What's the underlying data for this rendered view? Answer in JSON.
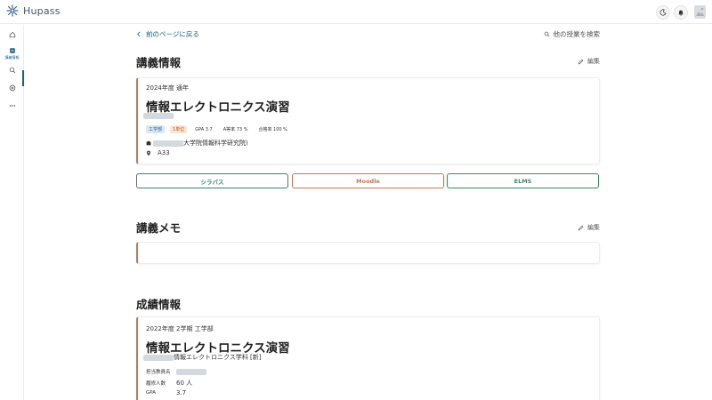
{
  "app": {
    "name": "Hupass"
  },
  "header": {
    "icons": [
      "theme-moon-icon",
      "notification-bell-icon",
      "user-avatar-icon"
    ]
  },
  "sidebar": {
    "items": [
      {
        "icon": "home-icon",
        "label": ""
      },
      {
        "icon": "course-info-icon",
        "label": "講義情報"
      },
      {
        "icon": "search-icon",
        "label": ""
      },
      {
        "icon": "add-circle-icon",
        "label": ""
      },
      {
        "icon": "more-icon",
        "label": ""
      }
    ]
  },
  "nav": {
    "back_label": "前のページに戻る",
    "search_label": "他の授業を検索"
  },
  "course_info": {
    "title": "講義情報",
    "edit_label": "編集",
    "year_term": "2024年度 通年",
    "course_name": "情報エレクトロニクス演習",
    "tags": [
      "工学部",
      "1単位",
      "GPA 3.7",
      "A等率 73 %",
      "合格率 100 %"
    ],
    "department": "大学院情報科学研究院)",
    "room": "A33",
    "buttons": {
      "syllabus": "シラバス",
      "moodle": "Moodle",
      "elms": "ELMS"
    }
  },
  "memo": {
    "title": "講義メモ",
    "edit_label": "編集"
  },
  "grades": {
    "title": "成績情報",
    "term": "2022年度 2学期 工学部",
    "course_name": "情報エレクトロニクス演習",
    "sub_dept": "情報エレクトロニクス学科 [新]",
    "teacher_label": "担当教員名",
    "students_label": "履修人数",
    "students_value": "60 人",
    "gpa_label": "GPA",
    "gpa_value": "3.7"
  },
  "colors": {
    "accent": "#1d5f86",
    "card_border": "#c9755a",
    "syllabus": "#3f7f72",
    "moodle": "#c9755a",
    "elms": "#3f8a5e"
  }
}
